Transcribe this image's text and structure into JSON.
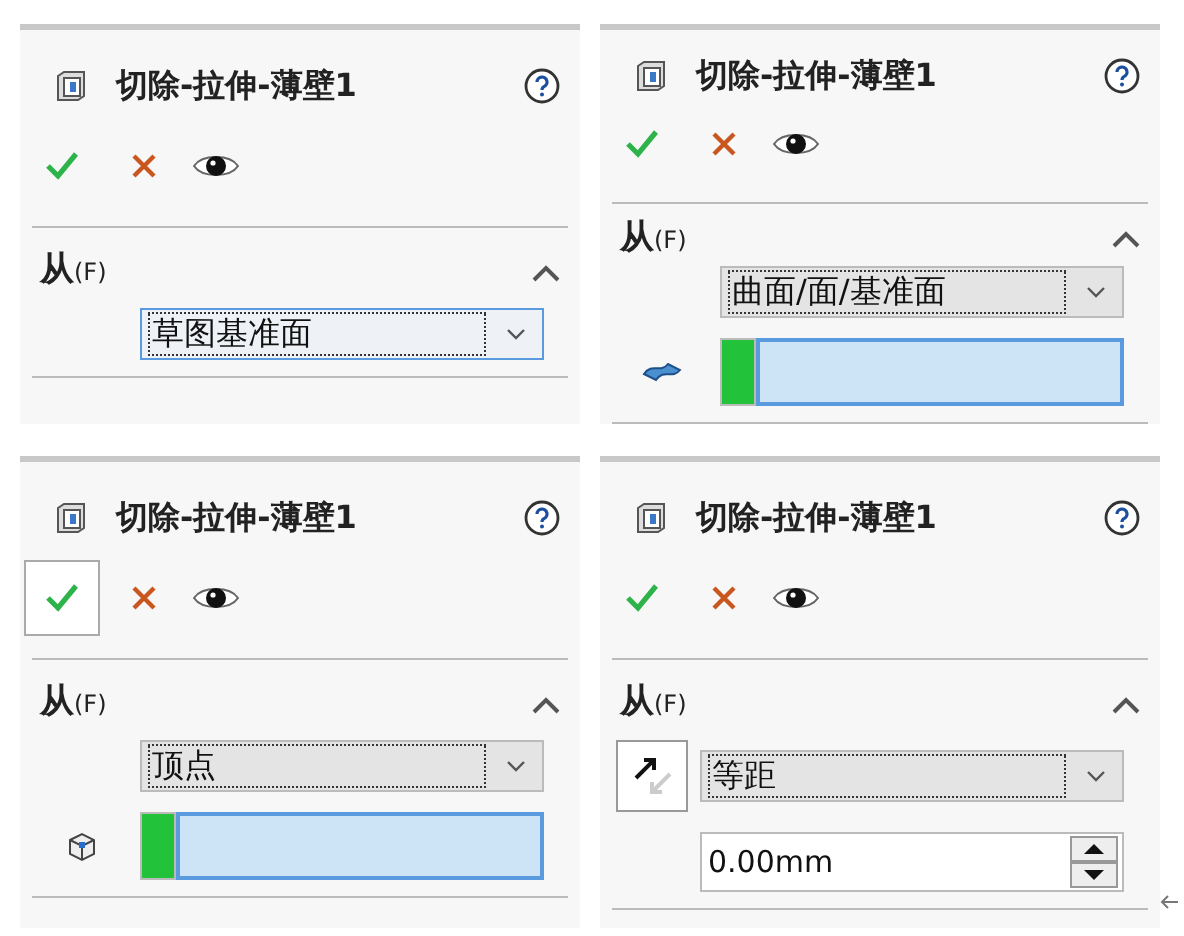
{
  "panels": [
    {
      "title": "切除-拉伸-薄壁1",
      "ok_focused": false,
      "section": {
        "label": "从",
        "mnemonic": "(F)",
        "expanded": true,
        "kind": "plane",
        "dropdown": {
          "value": "草图基准面",
          "focused": true
        }
      }
    },
    {
      "title": "切除-拉伸-薄壁1",
      "ok_focused": false,
      "section": {
        "label": "从",
        "mnemonic": "(F)",
        "expanded": true,
        "kind": "face_selection",
        "dropdown": {
          "value": "曲面/面/基准面",
          "focused": false
        }
      }
    },
    {
      "title": "切除-拉伸-薄壁1",
      "ok_focused": true,
      "section": {
        "label": "从",
        "mnemonic": "(F)",
        "expanded": true,
        "kind": "vertex_selection",
        "dropdown": {
          "value": "顶点",
          "focused": false
        }
      }
    },
    {
      "title": "切除-拉伸-薄壁1",
      "ok_focused": false,
      "section": {
        "label": "从",
        "mnemonic": "(F)",
        "expanded": true,
        "kind": "offset",
        "dropdown": {
          "value": "等距",
          "focused": false
        },
        "distance": "0.00mm"
      }
    }
  ]
}
